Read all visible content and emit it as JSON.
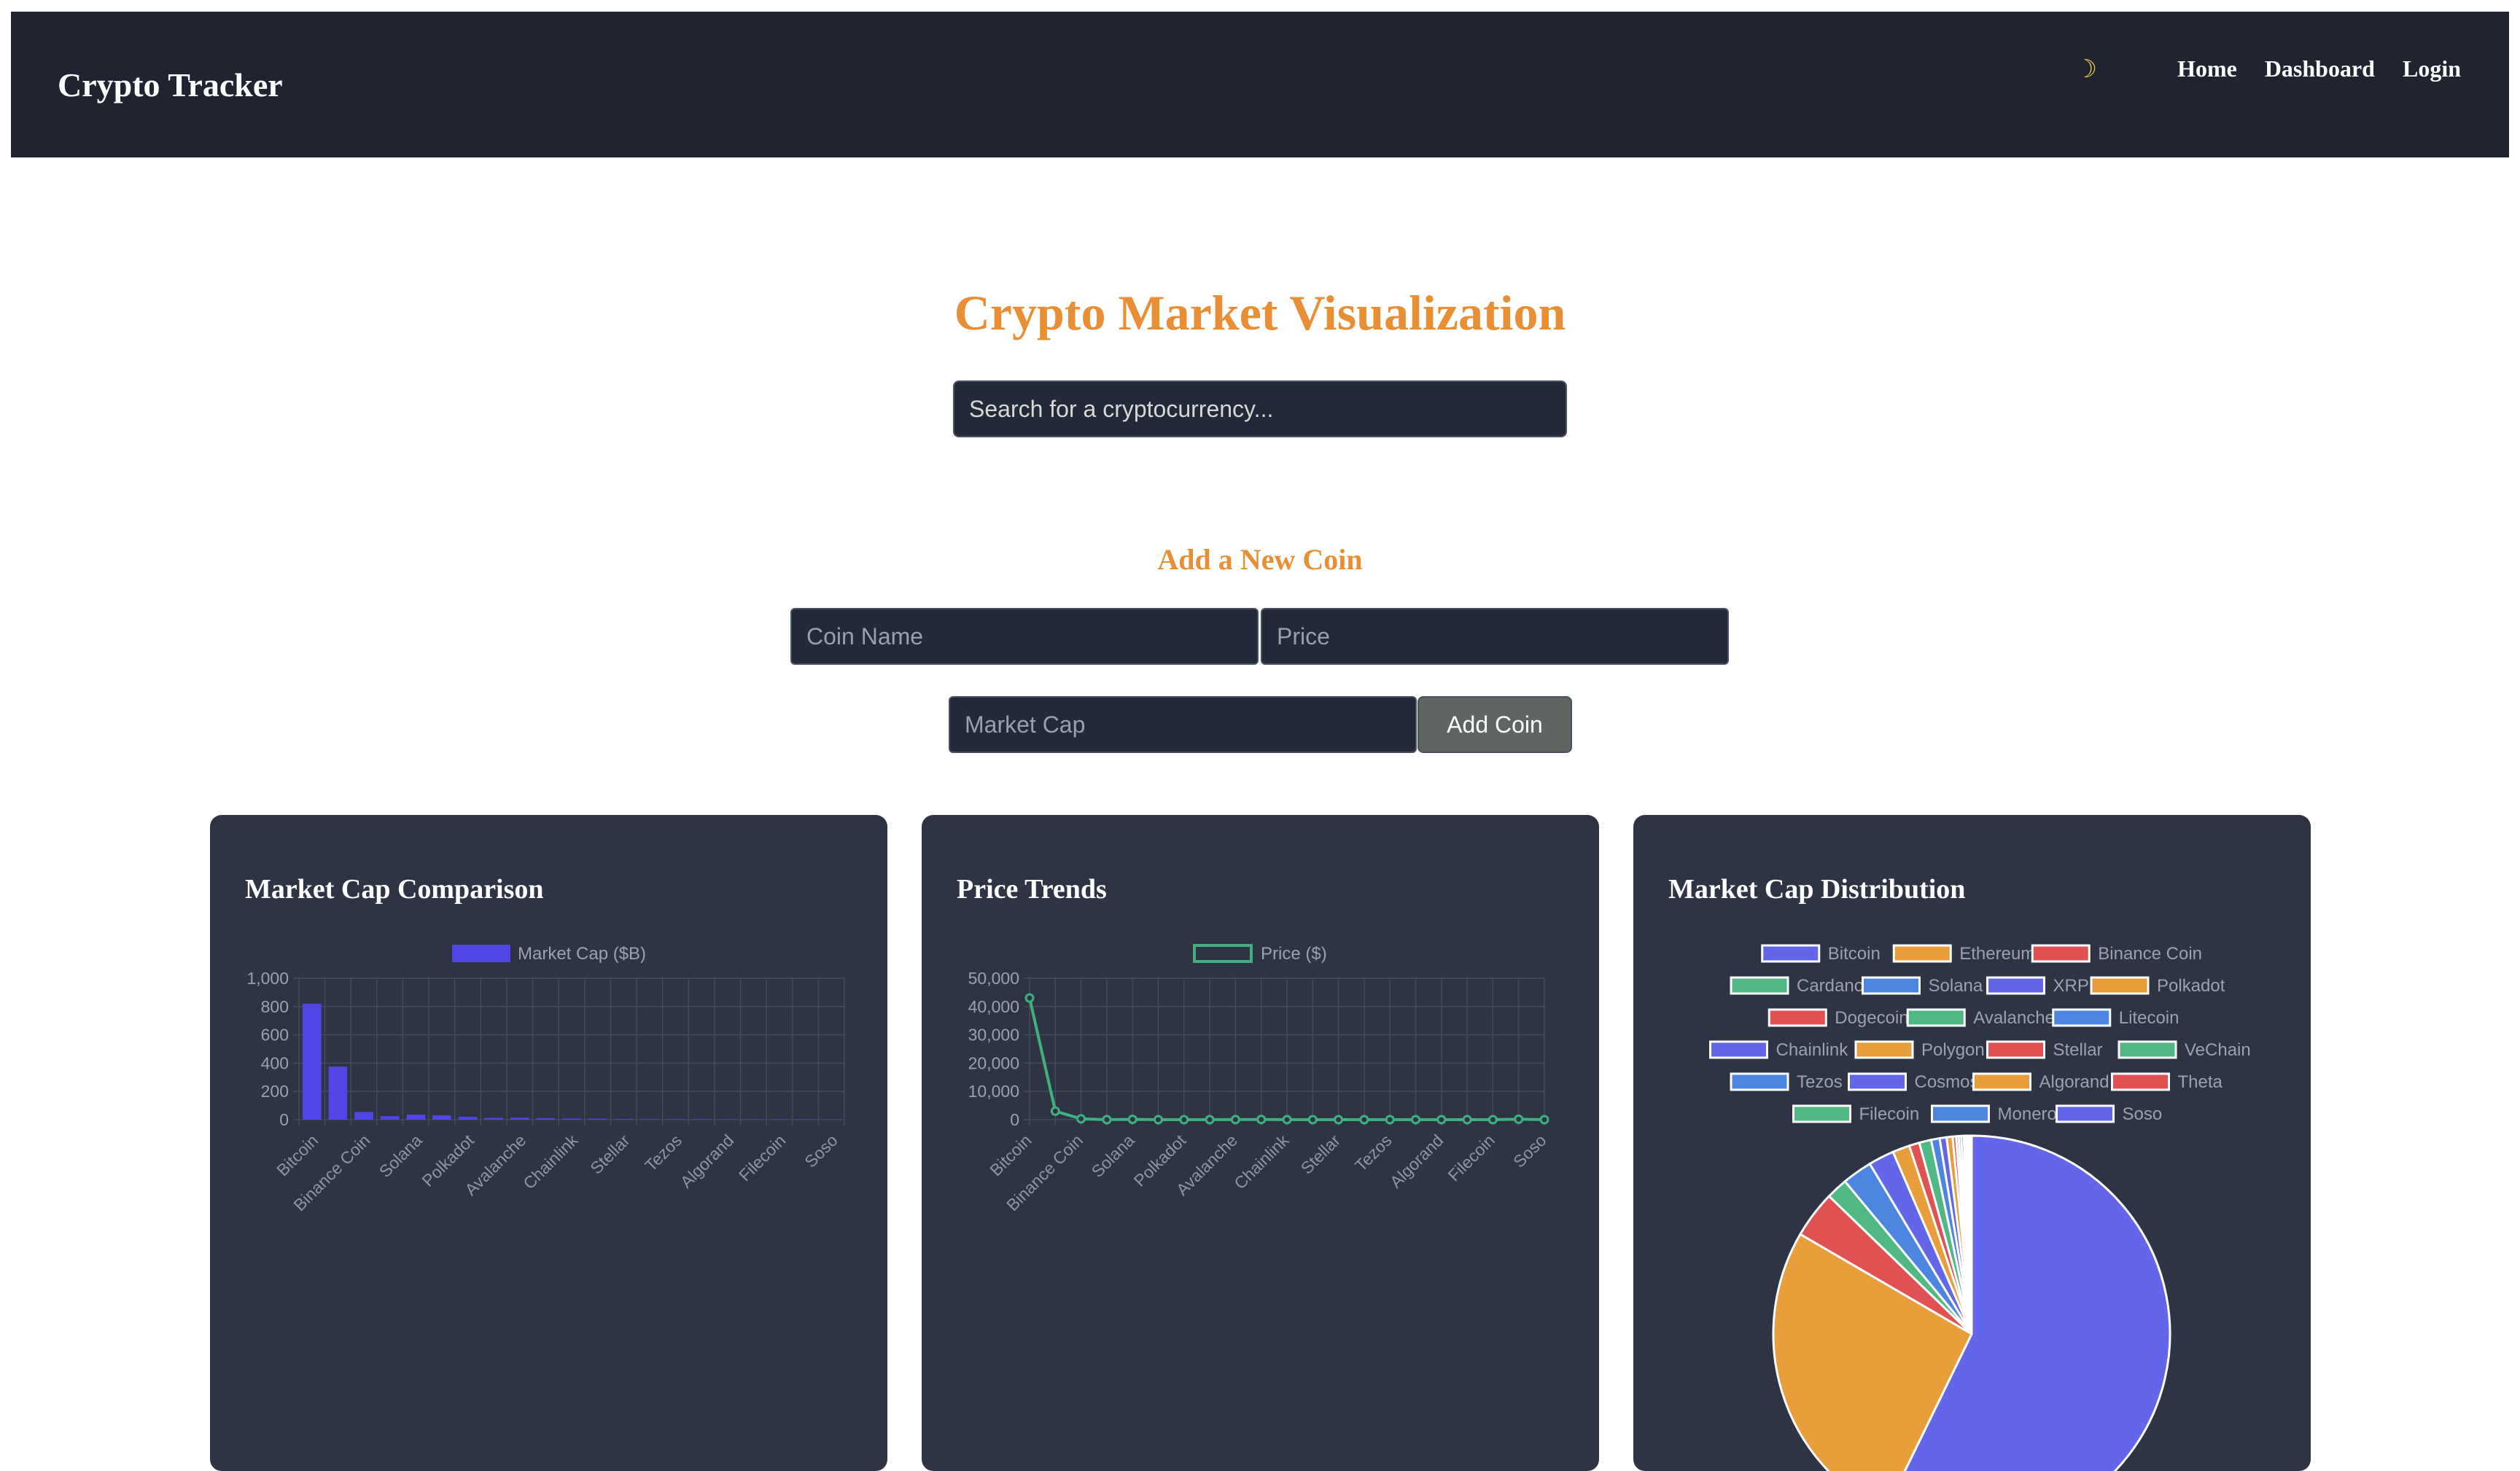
{
  "navbar": {
    "brand": "Crypto Tracker",
    "theme_toggle_icon": "moon-icon",
    "links": [
      "Home",
      "Dashboard",
      "Login"
    ]
  },
  "main": {
    "title": "Crypto Market Visualization",
    "search_placeholder": "Search for a cryptocurrency...",
    "add_coin": {
      "title": "Add a New Coin",
      "name_placeholder": "Coin Name",
      "price_placeholder": "Price",
      "market_cap_placeholder": "Market Cap",
      "button_label": "Add Coin"
    }
  },
  "colors": {
    "navbar_bg": "#1f2430",
    "accent_orange": "#e88f35",
    "card_bg": "#2e3444",
    "bar_blue": "#4f46e5",
    "line_green": "#3fb07f"
  },
  "chart_data": [
    {
      "type": "bar",
      "title": "Market Cap Comparison",
      "categories": [
        "Bitcoin",
        "Ethereum",
        "Binance Coin",
        "Cardano",
        "Solana",
        "XRP",
        "Polkadot",
        "Dogecoin",
        "Avalanche",
        "Litecoin",
        "Chainlink",
        "Polygon",
        "Stellar",
        "VeChain",
        "Tezos",
        "Cosmos",
        "Algorand",
        "Theta",
        "Filecoin",
        "Monero",
        "Soso"
      ],
      "tick_labels": [
        "Bitcoin",
        "Binance Coin",
        "Solana",
        "Polkadot",
        "Avalanche",
        "Chainlink",
        "Stellar",
        "Tezos",
        "Algorand",
        "Filecoin",
        "Soso"
      ],
      "series": [
        {
          "name": "Market Cap ($B)",
          "values": [
            820,
            375,
            55,
            25,
            35,
            30,
            20,
            12,
            14,
            10,
            8,
            7,
            4,
            3,
            3,
            3,
            2,
            2,
            2,
            2,
            1
          ]
        }
      ],
      "ylim": [
        0,
        1000
      ],
      "yticks": [
        "0",
        "200",
        "400",
        "600",
        "800",
        "1,000"
      ],
      "grid": true,
      "legend": "top"
    },
    {
      "type": "line",
      "title": "Price Trends",
      "categories": [
        "Bitcoin",
        "Ethereum",
        "Binance Coin",
        "Cardano",
        "Solana",
        "XRP",
        "Polkadot",
        "Dogecoin",
        "Avalanche",
        "Litecoin",
        "Chainlink",
        "Polygon",
        "Stellar",
        "VeChain",
        "Tezos",
        "Cosmos",
        "Algorand",
        "Theta",
        "Filecoin",
        "Monero",
        "Soso"
      ],
      "tick_labels": [
        "Bitcoin",
        "Binance Coin",
        "Solana",
        "Polkadot",
        "Avalanche",
        "Chainlink",
        "Stellar",
        "Tezos",
        "Algorand",
        "Filecoin",
        "Soso"
      ],
      "series": [
        {
          "name": "Price ($)",
          "values": [
            43000,
            3000,
            300,
            0.5,
            100,
            0.6,
            7,
            0.08,
            35,
            70,
            15,
            0.8,
            0.12,
            0.03,
            1,
            10,
            0.2,
            1,
            5,
            160,
            1
          ]
        }
      ],
      "ylim": [
        0,
        50000
      ],
      "yticks": [
        "0",
        "10,000",
        "20,000",
        "30,000",
        "40,000",
        "50,000"
      ],
      "grid": true,
      "legend": "top"
    },
    {
      "type": "pie",
      "title": "Market Cap Distribution",
      "labels": [
        "Bitcoin",
        "Ethereum",
        "Binance Coin",
        "Cardano",
        "Solana",
        "XRP",
        "Polkadot",
        "Dogecoin",
        "Avalanche",
        "Litecoin",
        "Chainlink",
        "Polygon",
        "Stellar",
        "VeChain",
        "Tezos",
        "Cosmos",
        "Algorand",
        "Theta",
        "Filecoin",
        "Monero",
        "Soso"
      ],
      "values": [
        820,
        375,
        55,
        25,
        35,
        30,
        20,
        12,
        14,
        10,
        8,
        7,
        4,
        3,
        3,
        3,
        2,
        2,
        2,
        2,
        1
      ],
      "colors": [
        "#6366e8",
        "#e89e3a",
        "#e05252",
        "#4fb883",
        "#4c86e0",
        "#6366e8",
        "#e89e3a",
        "#e05252",
        "#4fb883",
        "#4c86e0",
        "#6366e8",
        "#e89e3a",
        "#e05252",
        "#4fb883",
        "#4c86e0",
        "#6366e8",
        "#e89e3a",
        "#e05252",
        "#4fb883",
        "#4c86e0",
        "#6366e8"
      ],
      "legend": "top"
    }
  ]
}
